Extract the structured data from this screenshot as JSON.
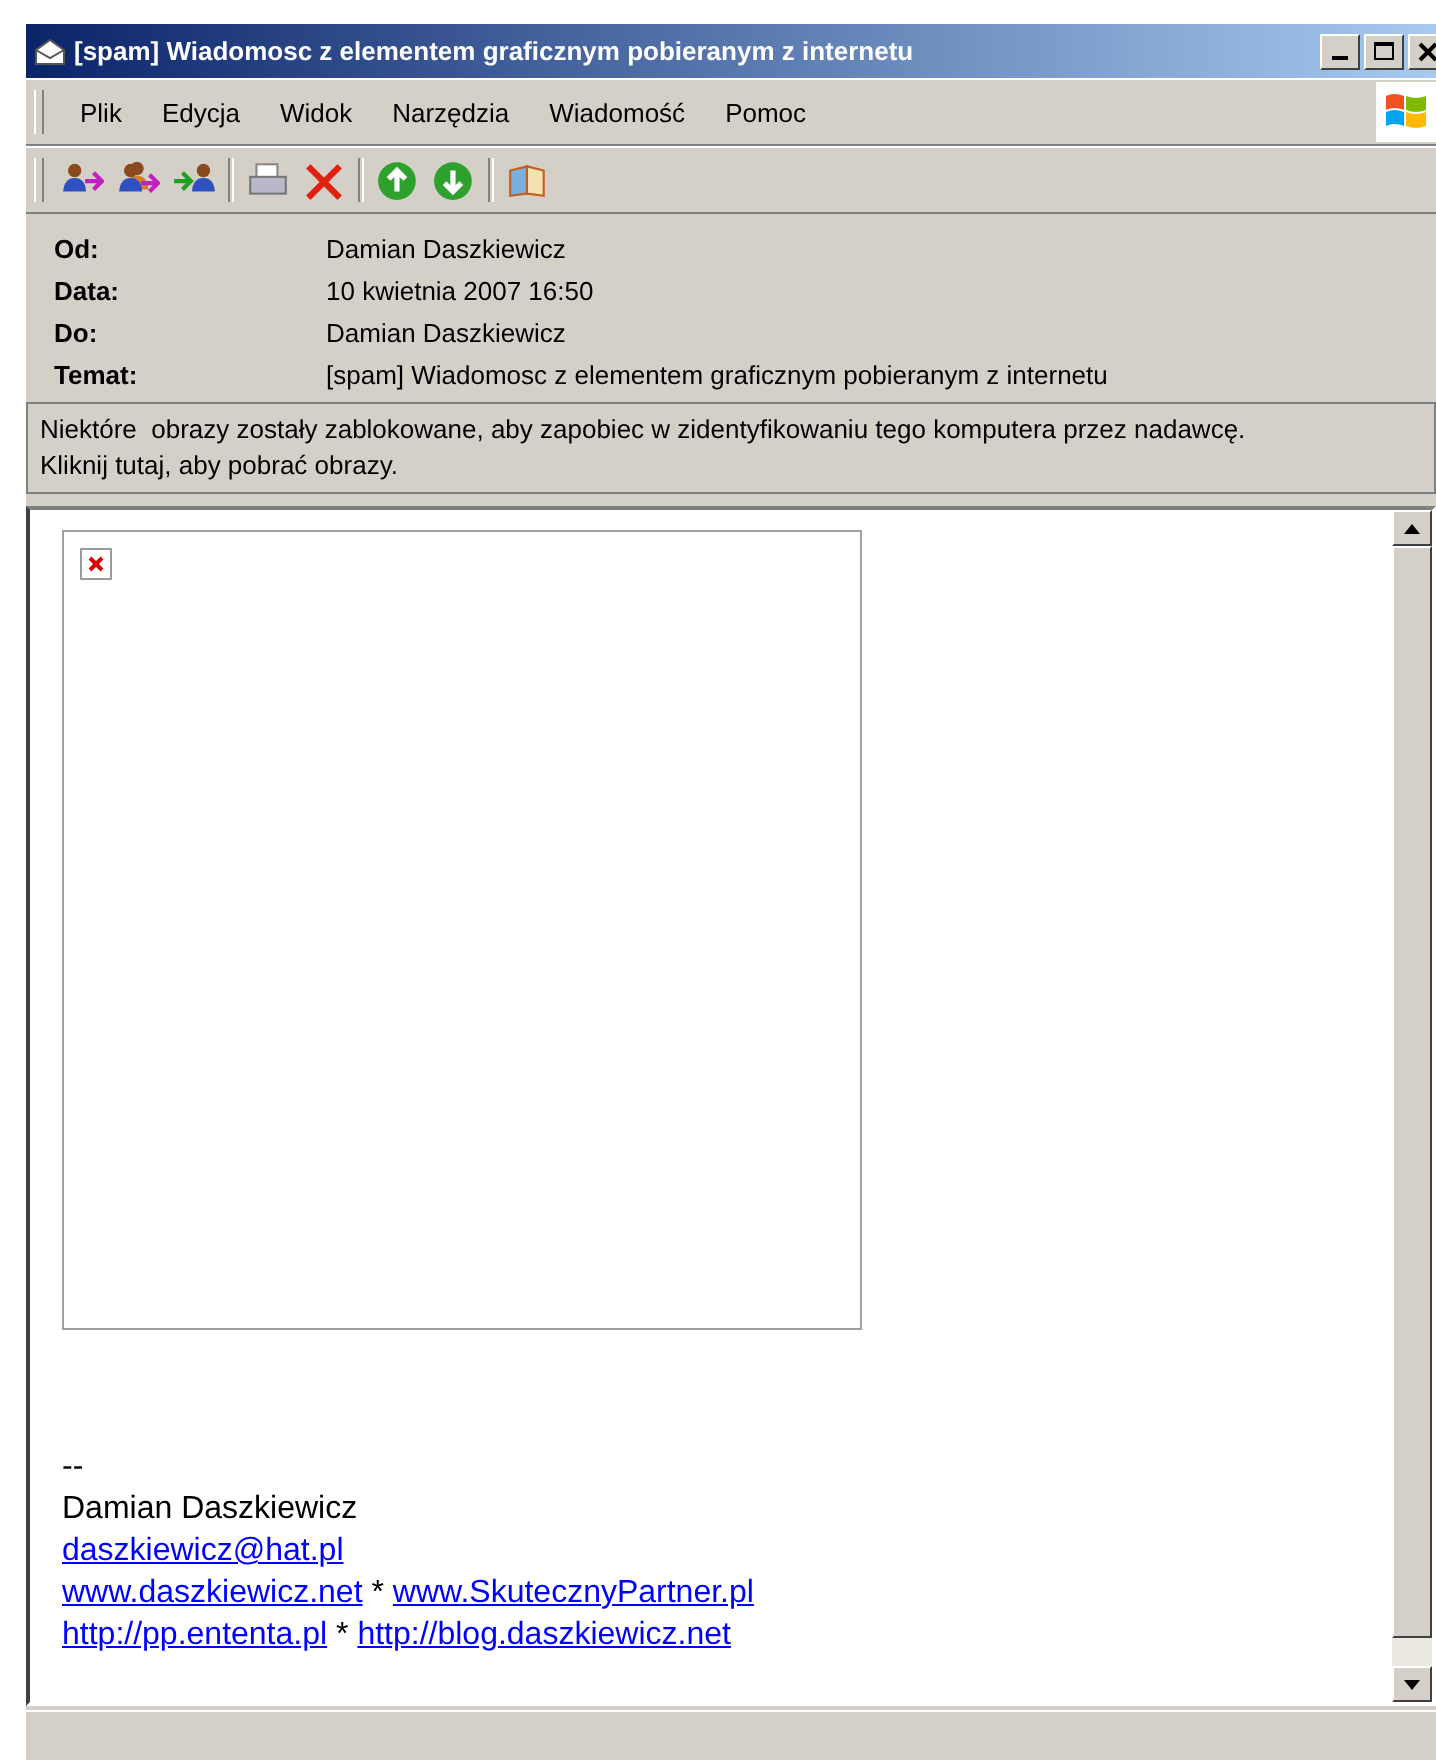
{
  "window": {
    "title": "[spam] Wiadomosc z elementem graficznym pobieranym z internetu"
  },
  "menu": [
    "Plik",
    "Edycja",
    "Widok",
    "Narzędzia",
    "Wiadomość",
    "Pomoc"
  ],
  "header": [
    {
      "label": "Od:",
      "value": "Damian Daszkiewicz"
    },
    {
      "label": "Data:",
      "value": "10 kwietnia 2007 16:50"
    },
    {
      "label": "Do:",
      "value": "Damian Daszkiewicz"
    },
    {
      "label": "Temat:",
      "value": "[spam] Wiadomosc z elementem graficznym pobieranym z internetu"
    }
  ],
  "info_bar": [
    "Niektóre  obrazy zostały zablokowane, aby zapobiec w zidentyfikowaniu tego komputera przez nadawcę.",
    "Kliknij tutaj, aby pobrać obrazy."
  ],
  "body": {
    "signature": [
      [
        {
          "kind": "text",
          "text": "--"
        }
      ],
      [
        {
          "kind": "text",
          "text": "Damian Daszkiewicz"
        }
      ],
      [
        {
          "kind": "link",
          "text": "daszkiewicz@hat.pl"
        }
      ],
      [
        {
          "kind": "link",
          "text": "www.daszkiewicz.net"
        },
        {
          "kind": "text",
          "text": "*"
        },
        {
          "kind": "link",
          "text": "www.SkutecznyPartner.pl"
        }
      ],
      [
        {
          "kind": "link",
          "text": "http://pp.ententa.pl"
        },
        {
          "kind": "text",
          "text": "*"
        },
        {
          "kind": "link",
          "text": "http://blog.daszkiewicz.net"
        }
      ]
    ]
  }
}
